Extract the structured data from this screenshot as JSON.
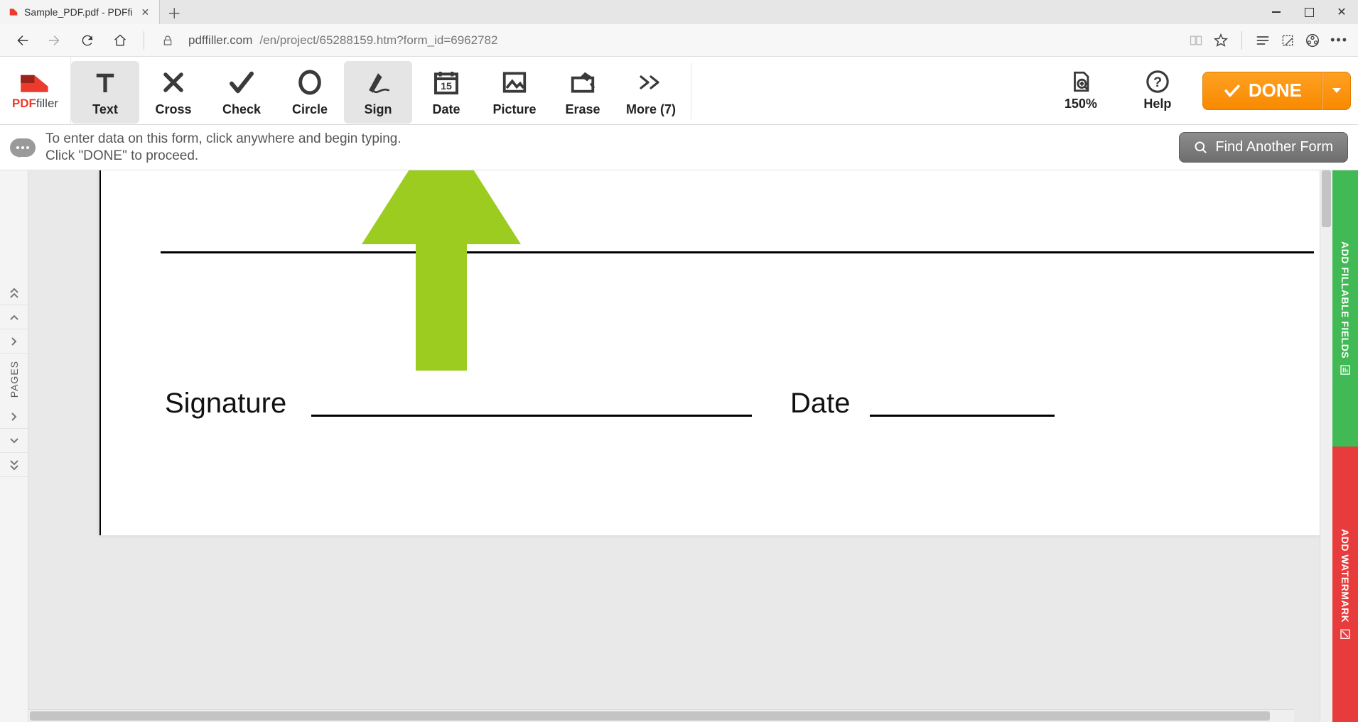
{
  "browser": {
    "tab_title": "Sample_PDF.pdf - PDFfi",
    "url_domain": "pdffiller.com",
    "url_path": "/en/project/65288159.htm?form_id=6962782"
  },
  "brand": {
    "name_primary": "PDF",
    "name_secondary": "filler"
  },
  "toolbar": {
    "text": "Text",
    "cross": "Cross",
    "check": "Check",
    "circle": "Circle",
    "sign": "Sign",
    "date": "Date",
    "picture": "Picture",
    "erase": "Erase",
    "more": "More (7)",
    "zoom": "150%",
    "help": "Help",
    "done": "DONE"
  },
  "hint": {
    "line1": "To enter data on this form, click anywhere and begin typing.",
    "line2": "Click \"DONE\" to proceed."
  },
  "find_another": "Find Another Form",
  "pages_sidebar": {
    "label": "PAGES"
  },
  "document": {
    "signature_label": "Signature",
    "date_label": "Date"
  },
  "side_rails": {
    "add_fillable": "ADD FILLABLE FIELDS",
    "add_watermark": "ADD WATERMARK"
  }
}
